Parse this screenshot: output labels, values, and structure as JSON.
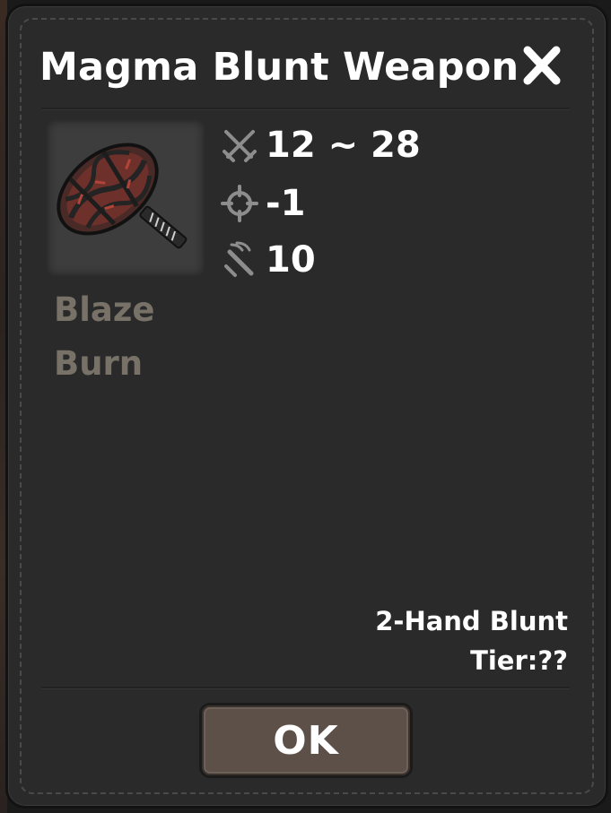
{
  "dialog": {
    "title": "Magma Blunt Weapon",
    "close_icon": "close-x-icon",
    "item_icon": "magma-hammer-icon",
    "stats": [
      {
        "icon": "crossed-swords-icon",
        "value": "12 ~ 28"
      },
      {
        "icon": "crosshair-icon",
        "value": "-1"
      },
      {
        "icon": "sword-speed-icon",
        "value": "10"
      }
    ],
    "traits": [
      "Blaze",
      "Burn"
    ],
    "weapon_type": "2-Hand Blunt",
    "tier": "Tier:??",
    "ok_label": "OK"
  },
  "colors": {
    "panel": "#2a2a2a",
    "trait_text": "#777168",
    "button": "#5c5048",
    "magma_red": "#7a3530"
  }
}
